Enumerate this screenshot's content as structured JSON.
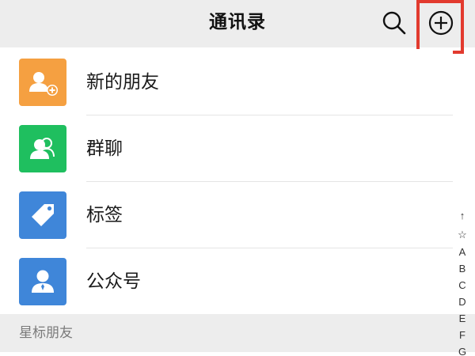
{
  "header": {
    "title": "通讯录",
    "search_icon": "search-icon",
    "add_icon": "add-circle-icon",
    "highlight_color": "#e23a2e"
  },
  "list": {
    "items": [
      {
        "label": "新的朋友",
        "icon": "add-friend-icon",
        "color": "#f5a041"
      },
      {
        "label": "群聊",
        "icon": "group-chat-icon",
        "color": "#1fbf5f"
      },
      {
        "label": "标签",
        "icon": "tag-icon",
        "color": "#3f86d9"
      },
      {
        "label": "公众号",
        "icon": "official-account-icon",
        "color": "#3f86d9"
      }
    ]
  },
  "section": {
    "label": "星标朋友"
  },
  "index_bar": [
    "↑",
    "☆",
    "A",
    "B",
    "C",
    "D",
    "E",
    "F",
    "G"
  ]
}
